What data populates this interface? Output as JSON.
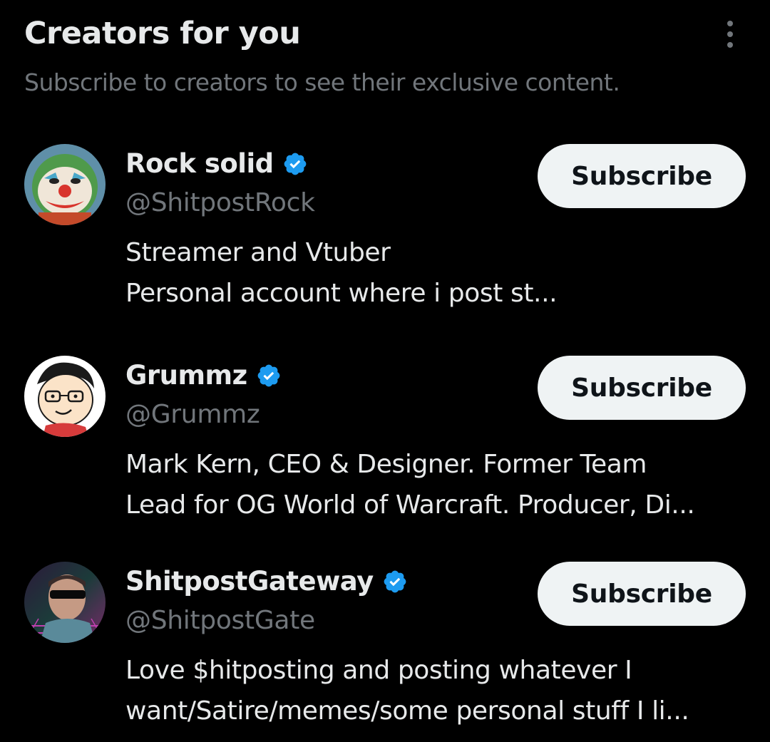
{
  "header": {
    "title": "Creators for you",
    "subtitle": "Subscribe to creators to see their exclusive content."
  },
  "accent_color": "#1d9bf0",
  "creators": [
    {
      "display_name": "Rock solid",
      "handle": "@ShitpostRock",
      "verified": true,
      "bio_lines": [
        "Streamer and Vtuber",
        "Personal account where i post st..."
      ],
      "button_label": "Subscribe"
    },
    {
      "display_name": "Grummz",
      "handle": "@Grummz",
      "verified": true,
      "bio_lines": [
        "Mark Kern, CEO & Designer. Former Team",
        "Lead for OG World of Warcraft. Producer, Di..."
      ],
      "button_label": "Subscribe"
    },
    {
      "display_name": "ShitpostGateway",
      "handle": "@ShitpostGate",
      "verified": true,
      "bio_lines": [
        "Love $hitposting and posting whatever I",
        "want/Satire/memes/some personal stuff I li..."
      ],
      "button_label": "Subscribe"
    }
  ]
}
